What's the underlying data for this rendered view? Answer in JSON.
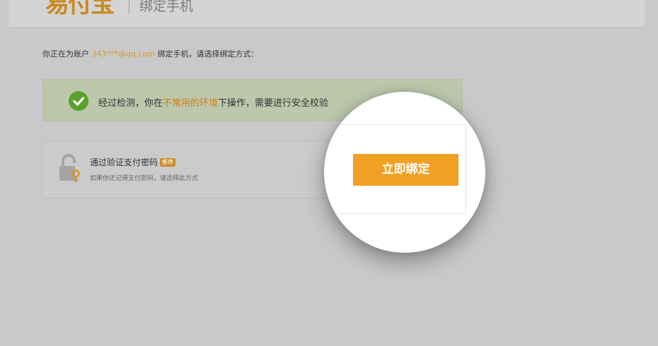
{
  "header": {
    "logo_text": "易付宝",
    "title": "绑定手机"
  },
  "intro": {
    "prefix": "你正在为账户 ",
    "email": "343***@qq.com",
    "suffix": " 绑定手机，请选择绑定方式："
  },
  "notice": {
    "text_before": "经过检测，你在",
    "highlight": "不常用的环境",
    "text_after": "下操作，需要进行安全校验",
    "icon": "check-icon"
  },
  "option": {
    "title": "通过验证支付密码",
    "badge": "推荐",
    "subtitle": "如果你还记得支付密码，请选择此方式",
    "icon": "lock-key-icon"
  },
  "action": {
    "bind_label": "立即绑定"
  },
  "colors": {
    "accent": "#f0a023",
    "success": "#5aa02c",
    "highlight_text": "#d07f1a"
  }
}
